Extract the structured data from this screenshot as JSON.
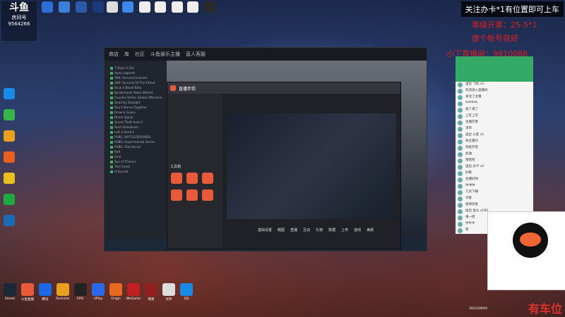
{
  "room": {
    "logo": "斗鱼",
    "label": "房间号",
    "number": "9564266"
  },
  "overlay": {
    "notice": "关注办卡*1有位置即可上车",
    "line1": "等级开黑：25-5*1",
    "line2": "度个帐号就好",
    "line3": "小丁直播间：9810088",
    "bottom_red": "有车位"
  },
  "steam": {
    "tabs": [
      "商店",
      "库",
      "社区",
      "斗鱼娱乐主播",
      "直人客服"
    ],
    "games": [
      "7 Days to Die",
      "Apex Legends",
      "ARK: Survival Evolved",
      "ARK: Survival Of The Fittest",
      "Back 4 Blood Beta",
      "Borderlands Tower Market",
      "Counter-Strike: Global Offensive",
      "Dead by Daylight",
      "Don't Starve Together",
      "Draw & Guess",
      "Ghost Signal",
      "Grand Theft Auto V",
      "Hunt Showdown",
      "Left 4 Dead 2",
      "PUBG: BATTLEGROUNDS",
      "PUBG: Experimental Server",
      "PUBG: Test Server",
      "Raft",
      "Rust",
      "Sea of Thieves",
      "The Forest",
      "Unturned"
    ]
  },
  "tool": {
    "title": "直播伴侣",
    "sections": [
      "工具箱"
    ],
    "tools": [
      "基础设置",
      "截图",
      "直播",
      "互动",
      "礼物",
      "数据",
      "上传",
      "连线",
      "美颜"
    ]
  },
  "chat": {
    "rows": [
      "送出 飞机 x1",
      "欢迎进入直播间",
      "关注了主播",
      "666666",
      "来了来了",
      "上车上车",
      "主播厉害",
      "求带",
      "送出 火箭 x1",
      "有位置吗",
      "等级开黑",
      "加油",
      "哈哈哈",
      "送出 办卡 x1",
      "好看",
      "主播好帅",
      "冲冲冲",
      "几点下播",
      "点歌",
      "谢谢老板",
      "送出 鱼丸 x100",
      "来一把",
      "牛牛牛",
      "赞",
      "晚上好",
      "求关注",
      "厉害了"
    ]
  },
  "taskbar": {
    "labels": [
      "Steam",
      "斗鱼直播",
      "腾讯",
      "Rockstar",
      "EPIC",
      "UPlay",
      "Origin",
      "WeGame",
      "网易",
      "文件",
      "QQ"
    ]
  },
  "clock": "2021/09/04"
}
